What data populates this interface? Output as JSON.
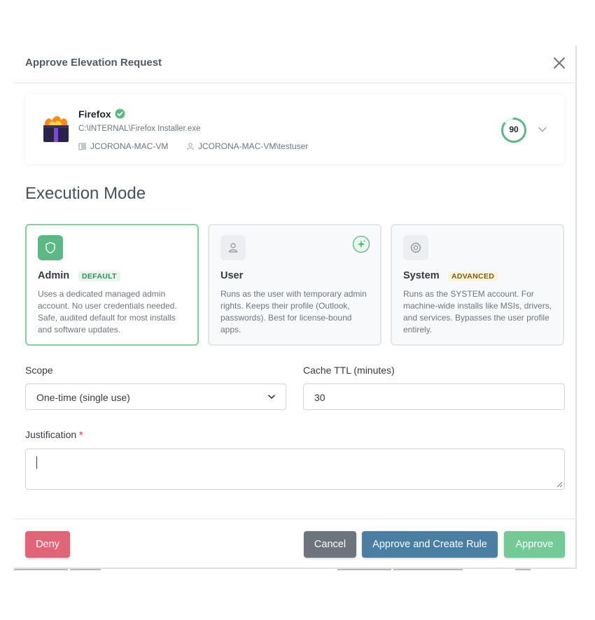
{
  "modal": {
    "title": "Approve Elevation Request"
  },
  "app": {
    "name": "Firefox",
    "path": "C:\\INTERNAL\\Firefox Installer.exe",
    "device": "JCORONA-MAC-VM",
    "user": "JCORONA-MAC-VM\\testuser",
    "score": "90",
    "score_percent": 85
  },
  "execution": {
    "title": "Execution Mode",
    "modes": [
      {
        "name": "Admin",
        "badge": "DEFAULT",
        "description": "Uses a dedicated managed admin account. No user credentials needed. Safe, audited default for most installs and software updates.",
        "selected": true
      },
      {
        "name": "User",
        "badge": "",
        "description": "Runs as the user with temporary admin rights. Keeps their profile (Outlook, passwords). Best for license-bound apps.",
        "selected": false
      },
      {
        "name": "System",
        "badge": "ADVANCED",
        "description": "Runs as the SYSTEM account. For machine-wide installs like MSIs, drivers, and services. Bypasses the user profile entirely.",
        "selected": false
      }
    ]
  },
  "form": {
    "scope_label": "Scope",
    "scope_value": "One-time (single use)",
    "ttl_label": "Cache TTL (minutes)",
    "ttl_value": "30",
    "justification_label": "Justification",
    "required_marker": "*",
    "justification_value": ""
  },
  "footer": {
    "deny_label": "Deny",
    "cancel_label": "Cancel",
    "approve_rule_label": "Approve and Create Rule",
    "approve_label": "Approve"
  },
  "colors": {
    "accent_green": "#5cb985",
    "deny": "#e06677",
    "rule": "#4a7ea3",
    "cancel": "#6c757d"
  },
  "icons": {
    "close": "close-icon",
    "verified": "check-circle-icon",
    "device": "device-icon",
    "user": "user-icon",
    "expand": "chevron-down-icon",
    "admin": "shield-icon",
    "user_mode": "person-icon",
    "system": "gear-icon",
    "recommended": "sparkle-icon"
  }
}
